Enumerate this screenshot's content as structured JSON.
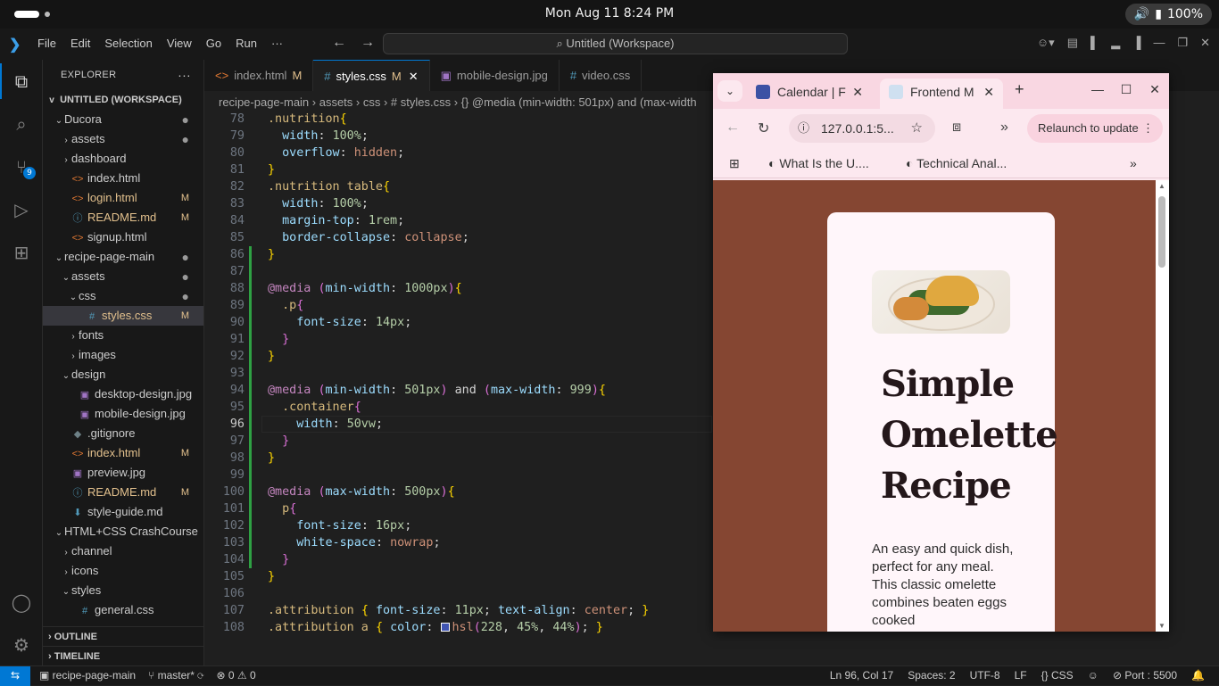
{
  "os": {
    "clock": "Mon Aug 11   8:24 PM",
    "battery": "100%"
  },
  "titlebar": {
    "menu": [
      "File",
      "Edit",
      "Selection",
      "View",
      "Go",
      "Run",
      "···"
    ],
    "command_center": "Untitled (Workspace)"
  },
  "activity": {
    "scm_badge": "9"
  },
  "explorer": {
    "header": "EXPLORER",
    "workspace": "UNTITLED (WORKSPACE)",
    "items": [
      {
        "depth": 1,
        "chev": "v",
        "icon": "",
        "label": "Ducora",
        "status": "●"
      },
      {
        "depth": 2,
        "chev": ">",
        "icon": "",
        "label": "assets",
        "status": "●"
      },
      {
        "depth": 2,
        "chev": ">",
        "icon": "",
        "label": "dashboard",
        "status": ""
      },
      {
        "depth": 2,
        "chev": "",
        "icon": "<>",
        "label": "index.html",
        "status": ""
      },
      {
        "depth": 2,
        "chev": "",
        "icon": "<>",
        "label": "login.html",
        "status": "M"
      },
      {
        "depth": 2,
        "chev": "",
        "icon": "ⓘ",
        "label": "README.md",
        "status": "M"
      },
      {
        "depth": 2,
        "chev": "",
        "icon": "<>",
        "label": "signup.html",
        "status": ""
      },
      {
        "depth": 1,
        "chev": "v",
        "icon": "",
        "label": "recipe-page-main",
        "status": "●"
      },
      {
        "depth": 2,
        "chev": "v",
        "icon": "",
        "label": "assets",
        "status": "●"
      },
      {
        "depth": 3,
        "chev": "v",
        "icon": "",
        "label": "css",
        "status": "●"
      },
      {
        "depth": 4,
        "chev": "",
        "icon": "#",
        "label": "styles.css",
        "status": "M",
        "selected": true
      },
      {
        "depth": 3,
        "chev": ">",
        "icon": "",
        "label": "fonts",
        "status": ""
      },
      {
        "depth": 3,
        "chev": ">",
        "icon": "",
        "label": "images",
        "status": ""
      },
      {
        "depth": 2,
        "chev": "v",
        "icon": "",
        "label": "design",
        "status": ""
      },
      {
        "depth": 3,
        "chev": "",
        "icon": "▣",
        "label": "desktop-design.jpg",
        "status": ""
      },
      {
        "depth": 3,
        "chev": "",
        "icon": "▣",
        "label": "mobile-design.jpg",
        "status": ""
      },
      {
        "depth": 2,
        "chev": "",
        "icon": "◆",
        "label": ".gitignore",
        "status": ""
      },
      {
        "depth": 2,
        "chev": "",
        "icon": "<>",
        "label": "index.html",
        "status": "M"
      },
      {
        "depth": 2,
        "chev": "",
        "icon": "▣",
        "label": "preview.jpg",
        "status": ""
      },
      {
        "depth": 2,
        "chev": "",
        "icon": "ⓘ",
        "label": "README.md",
        "status": "M"
      },
      {
        "depth": 2,
        "chev": "",
        "icon": "⬇",
        "label": "style-guide.md",
        "status": ""
      },
      {
        "depth": 1,
        "chev": "v",
        "icon": "",
        "label": "HTML+CSS CrashCourse",
        "status": ""
      },
      {
        "depth": 2,
        "chev": ">",
        "icon": "",
        "label": "channel",
        "status": ""
      },
      {
        "depth": 2,
        "chev": ">",
        "icon": "",
        "label": "icons",
        "status": ""
      },
      {
        "depth": 2,
        "chev": "v",
        "icon": "",
        "label": "styles",
        "status": ""
      },
      {
        "depth": 3,
        "chev": "",
        "icon": "#",
        "label": "general.css",
        "status": ""
      }
    ],
    "outline": "OUTLINE",
    "timeline": "TIMELINE"
  },
  "tabs": [
    {
      "icon": "<>",
      "label": "index.html",
      "mod": "M",
      "active": false
    },
    {
      "icon": "#",
      "label": "styles.css",
      "mod": "M",
      "active": true
    },
    {
      "icon": "▣",
      "label": "mobile-design.jpg",
      "mod": "",
      "active": false
    },
    {
      "icon": "#",
      "label": "video.css",
      "mod": "",
      "active": false
    }
  ],
  "breadcrumb": "recipe-page-main  ›  assets  ›  css  ›  # styles.css  ›  {} @media (min-width: 501px) and (max-width",
  "code_start_line": 78,
  "current_line": 96,
  "status": {
    "branch": "recipe-page-main",
    "git": "master*",
    "problems": "⊗ 0 ⚠ 0",
    "cursor": "Ln 96, Col 17",
    "spaces": "Spaces: 2",
    "encoding": "UTF-8",
    "eol": "LF",
    "lang": "CSS",
    "port": "Port : 5500"
  },
  "browser": {
    "tabs": [
      {
        "label": "Calendar | F",
        "active": false
      },
      {
        "label": "Frontend M",
        "active": true
      }
    ],
    "url": "127.0.0.1:5...",
    "relaunch": "Relaunch to update",
    "bookmarks": [
      "What Is the U....",
      "Technical Anal..."
    ],
    "page": {
      "title": [
        "Simple",
        "Omelette",
        "Recipe"
      ],
      "description": "An easy and quick dish, perfect for any meal. This classic omelette combines beaten eggs cooked"
    }
  }
}
